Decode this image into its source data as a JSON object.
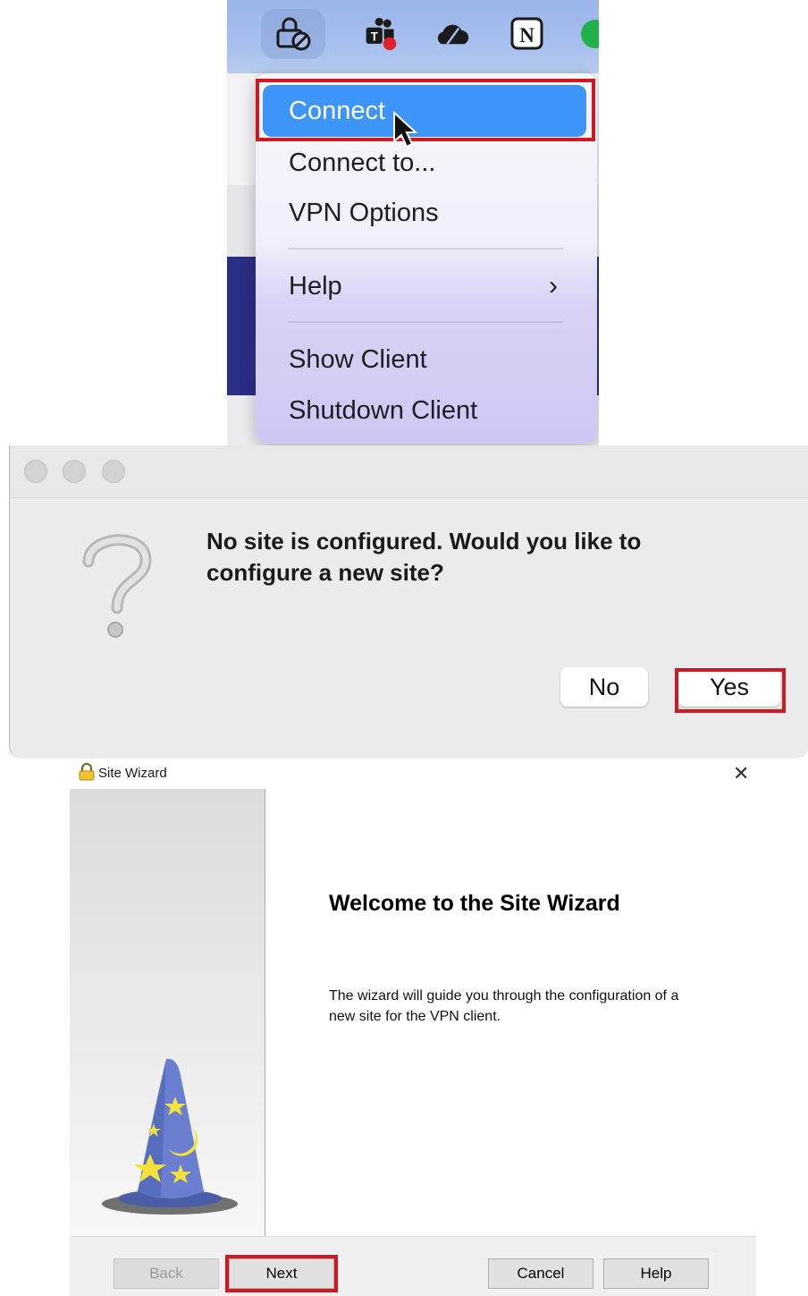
{
  "menu_bar": {
    "icons": [
      "vpn-lock-icon",
      "teams-icon",
      "cloud-icon",
      "notion-icon",
      "line-icon"
    ],
    "notion_letter": "N",
    "teams_letter": "T"
  },
  "vpn_menu": {
    "items": [
      {
        "label": "Connect"
      },
      {
        "label": "Connect to..."
      },
      {
        "label": "VPN Options"
      },
      {
        "label": "Help"
      },
      {
        "label": "Show Client"
      },
      {
        "label": "Shutdown Client"
      }
    ],
    "help_chevron": "›"
  },
  "dialog": {
    "message": "No site is configured. Would you like to configure a new site?",
    "no_label": "No",
    "yes_label": "Yes"
  },
  "wizard": {
    "title": "Site Wizard",
    "heading": "Welcome to the Site Wizard",
    "description": "The wizard will guide you through the configuration of a new site for the VPN client.",
    "buttons": {
      "back": "Back",
      "next": "Next",
      "cancel": "Cancel",
      "help": "Help"
    },
    "close_glyph": "✕"
  },
  "colors": {
    "highlight": "#3e95f8",
    "annotation_red": "#d11820"
  }
}
